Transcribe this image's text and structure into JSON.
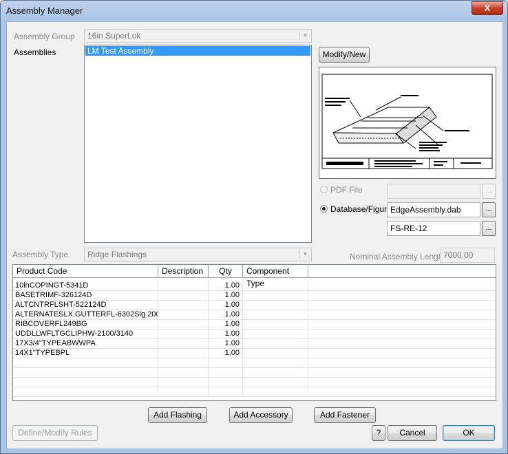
{
  "window": {
    "title": "Assembly Manager",
    "close_glyph": "X"
  },
  "assembly_group": {
    "label": "Assembly Group",
    "value": "16in SuperLok"
  },
  "assemblies": {
    "label": "Assemblies",
    "items": [
      "LM Test Assembly"
    ],
    "selected": "LM Test Assembly"
  },
  "modify_new_label": "Modify/New",
  "source": {
    "pdf_label": "PDF File",
    "pdf_value": "",
    "db_label": "Database/Figure",
    "db_file": "EdgeAssembly.dab",
    "figure": "FS-RE-12",
    "browse_label": "...",
    "selected": "database"
  },
  "assembly_type": {
    "label": "Assembly Type",
    "value": "Ridge Flashings"
  },
  "nominal_length": {
    "label": "Nominal Assembly Length",
    "value": "7000.00"
  },
  "table": {
    "headers": [
      "Product Code",
      "Description",
      "Qty",
      "Component Type"
    ],
    "rows": [
      {
        "code": "10inCOPINGT-5341D",
        "desc": "",
        "qty": "1.00",
        "type": ""
      },
      {
        "code": "BASETRIMF-326124D",
        "desc": "",
        "qty": "1.00",
        "type": ""
      },
      {
        "code": "ALTCNTRFLSHT-522124D",
        "desc": "",
        "qty": "1.00",
        "type": ""
      },
      {
        "code": "ALTERNATESLX GUTTERFL-6302Sig 200",
        "desc": "",
        "qty": "1.00",
        "type": ""
      },
      {
        "code": "RIBCOVERFL249BG",
        "desc": "",
        "qty": "1.00",
        "type": ""
      },
      {
        "code": "UDDLLWFLTGCLIPHW-2100/3140",
        "desc": "",
        "qty": "1.00",
        "type": ""
      },
      {
        "code": "17X3/4\"TYPEABWWPA",
        "desc": "",
        "qty": "1.00",
        "type": ""
      },
      {
        "code": "14X1\"TYPEBPL",
        "desc": "",
        "qty": "1.00",
        "type": ""
      }
    ]
  },
  "buttons": {
    "add_flashing": "Add Flashing",
    "add_accessory": "Add Accessory",
    "add_fastener": "Add Fastener",
    "define_rules": "Define/Modify Rules",
    "help": "?",
    "cancel": "Cancel",
    "ok": "OK"
  },
  "icons": {
    "dropdown": "chevron-down-icon",
    "close": "close-icon",
    "radio": "radio-icon"
  }
}
